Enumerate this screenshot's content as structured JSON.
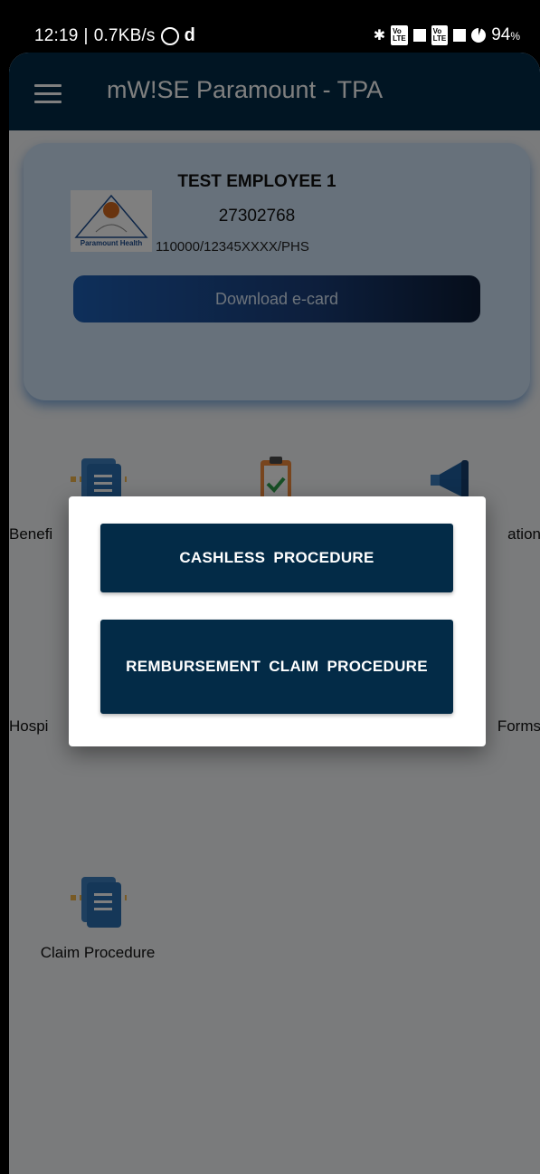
{
  "status_bar": {
    "time": "12:19",
    "net_speed": "0.7KB/s",
    "battery": "94",
    "battery_unit": "%"
  },
  "appbar": {
    "title": "mW!SE Paramount - TPA"
  },
  "card": {
    "logo_text": "Paramount Health",
    "employee_name": "TEST EMPLOYEE 1",
    "employee_id": "27302768",
    "policy_number": "110000/12345XXXX/PHS",
    "download_button": "Download e-card"
  },
  "tiles": [
    {
      "label": "Benefits & ...",
      "visible_label": "Benefi"
    },
    {
      "label": "",
      "visible_label": ""
    },
    {
      "label": "...ation",
      "visible_label": "ation"
    },
    {
      "label": "Hospi...",
      "visible_label": "Hospi"
    },
    {
      "label": "",
      "visible_label": ""
    },
    {
      "label": "...Forms",
      "visible_label": "Forms"
    },
    {
      "label": "Claim Procedure",
      "visible_label": "Claim Procedure"
    }
  ],
  "modal": {
    "cashless_label": "CASHLESS  PROCEDURE",
    "reimbursement_label": "REMBURSEMENT  CLAIM  PROCEDURE"
  }
}
